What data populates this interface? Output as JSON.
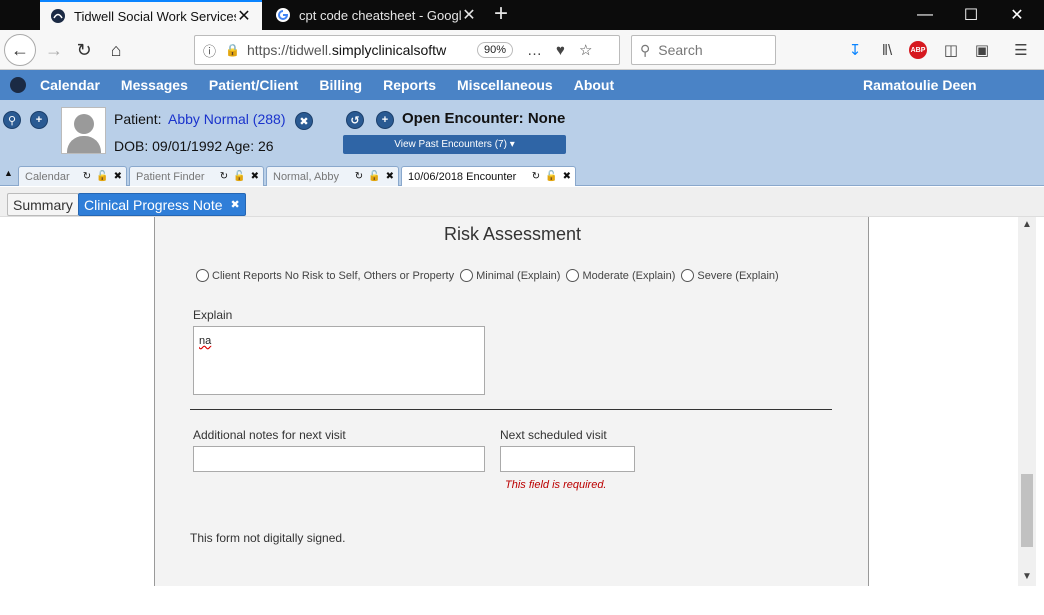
{
  "browser": {
    "tabs": [
      {
        "title": "Tidwell Social Work Services an",
        "active": true
      },
      {
        "title": "cpt code cheatsheet - Google S",
        "active": false
      }
    ],
    "close_glyph": "✕",
    "new_tab_glyph": "+",
    "url_prefix": "https://tidwell.",
    "url_host": "simplyclinicalsoftw",
    "zoom": "90%",
    "search_placeholder": "Search"
  },
  "app_menu": {
    "items": [
      "Calendar",
      "Messages",
      "Patient/Client",
      "Billing",
      "Reports",
      "Miscellaneous",
      "About"
    ],
    "user": "Ramatoulie Deen"
  },
  "patient": {
    "label": "Patient:",
    "name": "Abby Normal (288)",
    "dob_line": "DOB: 09/01/1992 Age: 26",
    "encounter_label": "Open Encounter:",
    "encounter_value": "None",
    "past_encounters_button": "View Past Encounters  (7) ▾"
  },
  "frame_tabs": [
    {
      "label": "Calendar",
      "active": false
    },
    {
      "label": "Patient Finder",
      "active": false
    },
    {
      "label": "Normal, Abby",
      "active": false
    },
    {
      "label": "10/06/2018 Encounter",
      "active": true
    }
  ],
  "sub_tabs": {
    "summary": "Summary",
    "current": "Clinical Progress Note",
    "close_glyph": "✖"
  },
  "form": {
    "title": "Risk Assessment",
    "risk_options": [
      "Client Reports No Risk to Self, Others or Property",
      "Minimal (Explain)",
      "Moderate (Explain)",
      "Severe (Explain)"
    ],
    "explain_label": "Explain",
    "explain_value": "na",
    "additional_notes_label": "Additional notes for next visit",
    "additional_notes_value": "",
    "next_visit_label": "Next scheduled visit",
    "next_visit_value": "",
    "required_message": "This field is required.",
    "signature_status": "This form not digitally signed."
  },
  "colors": {
    "menu_bar": "#4a83c6",
    "patient_header": "#b9cfe8",
    "active_sub_tab": "#2f7ed8",
    "error_text": "#bb0000",
    "patient_link": "#1a33cc"
  }
}
